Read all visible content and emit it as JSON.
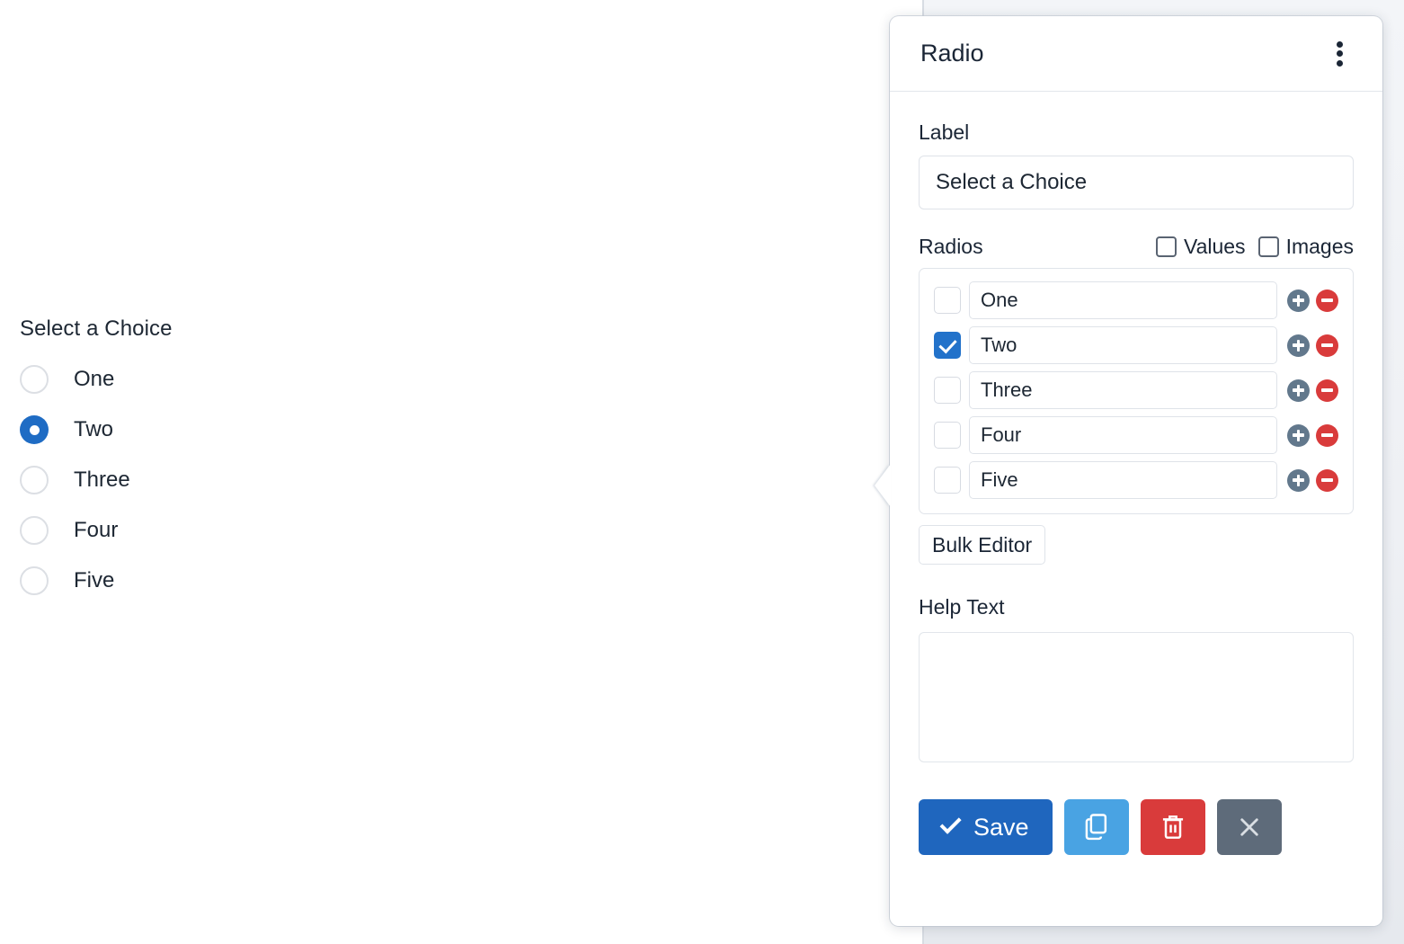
{
  "preview": {
    "title": "Select a Choice",
    "options": [
      {
        "label": "One",
        "selected": false
      },
      {
        "label": "Two",
        "selected": true
      },
      {
        "label": "Three",
        "selected": false
      },
      {
        "label": "Four",
        "selected": false
      },
      {
        "label": "Five",
        "selected": false
      }
    ]
  },
  "panel": {
    "title": "Radio",
    "menu_icon": "kebab-menu-icon",
    "label_heading": "Label",
    "label_value": "Select a Choice",
    "label_placeholder": "",
    "radios_heading": "Radios",
    "toggles": [
      {
        "label": "Values",
        "checked": false
      },
      {
        "label": "Images",
        "checked": false
      }
    ],
    "radio_rows": [
      {
        "checked": false,
        "value": "One",
        "add_icon": "plus-circle-icon",
        "remove_icon": "minus-circle-icon"
      },
      {
        "checked": true,
        "value": "Two",
        "add_icon": "plus-circle-icon",
        "remove_icon": "minus-circle-icon"
      },
      {
        "checked": false,
        "value": "Three",
        "add_icon": "plus-circle-icon",
        "remove_icon": "minus-circle-icon"
      },
      {
        "checked": false,
        "value": "Four",
        "add_icon": "plus-circle-icon",
        "remove_icon": "minus-circle-icon"
      },
      {
        "checked": false,
        "value": "Five",
        "add_icon": "plus-circle-icon",
        "remove_icon": "minus-circle-icon"
      }
    ],
    "bulk_editor_label": "Bulk Editor",
    "help_text_heading": "Help Text",
    "help_text_value": "",
    "help_text_placeholder": "",
    "footer": {
      "save_label": "Save",
      "save_icon": "check-icon",
      "copy_icon": "copy-icon",
      "delete_icon": "trash-icon",
      "close_icon": "close-x-icon"
    }
  },
  "colors": {
    "accent_blue": "#1f66be",
    "radio_selected": "#1f6cc4",
    "checkbox_checked": "#2272ca",
    "add_button": "#62788c",
    "remove_button": "#d93b3b",
    "copy_button": "#49a3e3",
    "delete_button": "#d93b3b",
    "close_button": "#5e6b7a",
    "text_dark": "#1b2636",
    "panel_bg": "#ffffff",
    "side_bg": "#eef0f4"
  }
}
